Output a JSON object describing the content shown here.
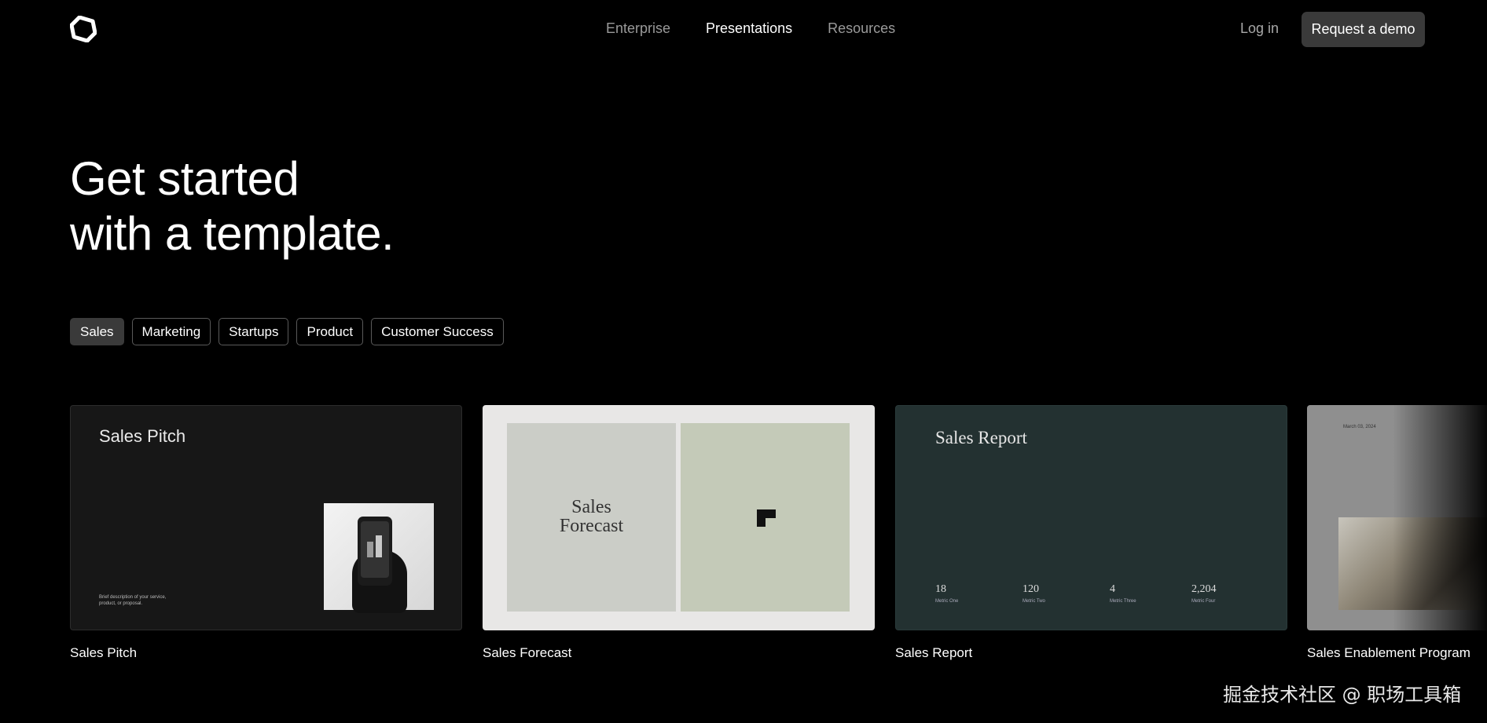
{
  "header": {
    "logo_icon": "hexagon-outline-logo",
    "nav": [
      "Enterprise",
      "Presentations",
      "Resources"
    ],
    "active_nav": "Presentations",
    "login_label": "Log in",
    "demo_label": "Request a demo"
  },
  "hero": {
    "line1": "Get started",
    "line2": "with a template."
  },
  "filters": {
    "items": [
      "Sales",
      "Marketing",
      "Startups",
      "Product",
      "Customer Success"
    ],
    "active": "Sales"
  },
  "cards": [
    {
      "label": "Sales Pitch",
      "thumb_title": "Sales Pitch",
      "thumb_desc": "Brief description of your service, product, or proposal."
    },
    {
      "label": "Sales Forecast",
      "thumb_title_line1": "Sales",
      "thumb_title_line2": "Forecast"
    },
    {
      "label": "Sales Report",
      "thumb_title": "Sales Report",
      "metrics": [
        {
          "value": "18",
          "caption": "Metric One"
        },
        {
          "value": "120",
          "caption": "Metric Two"
        },
        {
          "value": "4",
          "caption": "Metric Three"
        },
        {
          "value": "2,204",
          "caption": "Metric Four"
        }
      ]
    },
    {
      "label": "Sales Enablement Program",
      "thumb_date": "March 03, 2024"
    }
  ],
  "watermark": "掘金技术社区 @ 职场工具箱",
  "colors": {
    "background": "#000000",
    "button_bg": "#3a3a3a",
    "report_bg": "#233131",
    "forecast_left": "#cbcdc7",
    "forecast_right": "#c4cab8"
  }
}
